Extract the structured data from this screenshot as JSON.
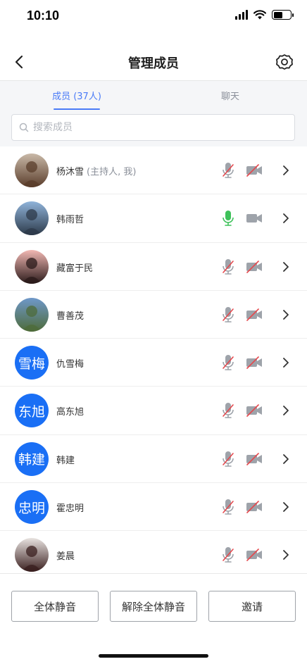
{
  "status_bar": {
    "time": "10:10",
    "battery_level": 0.55
  },
  "nav": {
    "title": "管理成员",
    "back_icon": "chevron-left-icon",
    "settings_icon": "gear-icon"
  },
  "tabs": [
    {
      "label": "成员 (37人)",
      "active": true
    },
    {
      "label": "聊天",
      "active": false
    }
  ],
  "search": {
    "placeholder": "搜索成员"
  },
  "members": [
    {
      "name": "杨沐雪",
      "tag": "(主持人, 我)",
      "avatar_type": "photo",
      "avatar_palette": [
        "#c9b9a8",
        "#5a3d2b"
      ],
      "mic": "muted",
      "camera": "off"
    },
    {
      "name": "韩雨哲",
      "tag": "",
      "avatar_type": "photo",
      "avatar_palette": [
        "#8fb3d9",
        "#2d3a4a"
      ],
      "mic": "on",
      "camera": "on"
    },
    {
      "name": "藏富于民",
      "tag": "",
      "avatar_type": "photo",
      "avatar_palette": [
        "#f2b8b3",
        "#2a1a1a"
      ],
      "mic": "muted",
      "camera": "off"
    },
    {
      "name": "曹善茂",
      "tag": "",
      "avatar_type": "photo",
      "avatar_palette": [
        "#6f98c9",
        "#4e6b3a"
      ],
      "mic": "muted",
      "camera": "off"
    },
    {
      "name": "仇雪梅",
      "tag": "",
      "avatar_type": "text",
      "avatar_text": "雪梅",
      "mic": "muted",
      "camera": "off"
    },
    {
      "name": "高东旭",
      "tag": "",
      "avatar_type": "text",
      "avatar_text": "东旭",
      "mic": "muted",
      "camera": "off"
    },
    {
      "name": "韩建",
      "tag": "",
      "avatar_type": "text",
      "avatar_text": "韩建",
      "mic": "muted",
      "camera": "off"
    },
    {
      "name": "霍忠明",
      "tag": "",
      "avatar_type": "text",
      "avatar_text": "忠明",
      "mic": "muted",
      "camera": "off"
    },
    {
      "name": "姜晨",
      "tag": "",
      "avatar_type": "photo",
      "avatar_palette": [
        "#e8e3e0",
        "#3a1f1f"
      ],
      "mic": "muted",
      "camera": "off"
    }
  ],
  "actions": {
    "mute_all": "全体静音",
    "unmute_all": "解除全体静音",
    "invite": "邀请"
  },
  "colors": {
    "accent": "#4a7bf7",
    "avatar_blue": "#1a6ff5",
    "mic_on": "#3ec15a",
    "muted_slash": "#e5484d",
    "icon_gray": "#9ea3aa"
  }
}
